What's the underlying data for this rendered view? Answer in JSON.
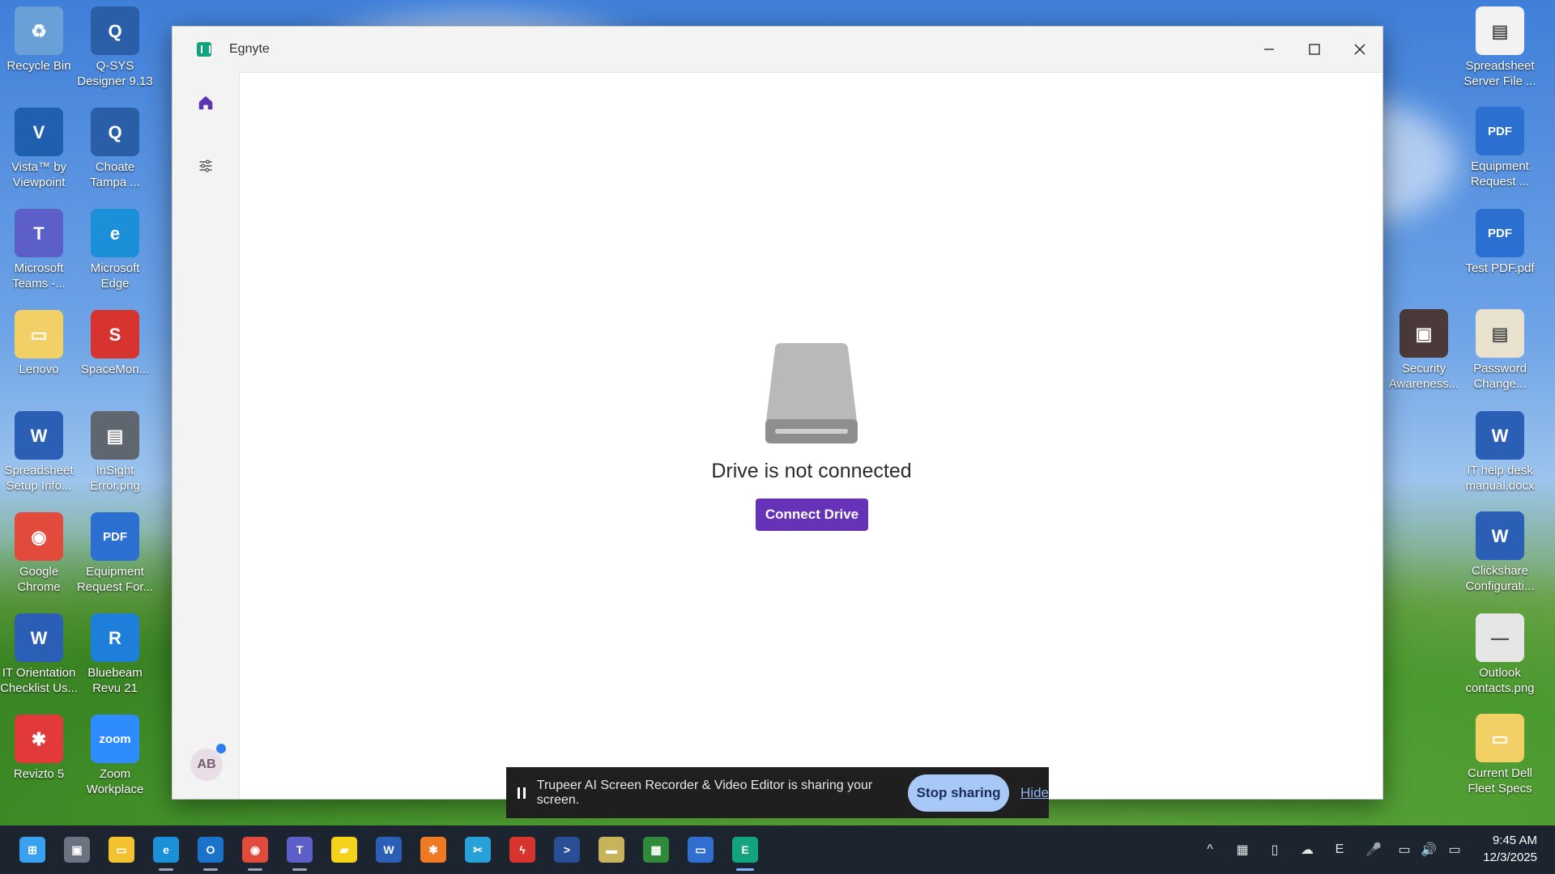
{
  "window": {
    "title": "Egnyte",
    "controls": {
      "minimize": "minimize-icon",
      "maximize": "maximize-icon",
      "close": "close-icon"
    }
  },
  "sidebar": {
    "home_icon": "home-icon",
    "settings_icon": "sliders-icon",
    "avatar_initials": "AB"
  },
  "main": {
    "status_text": "Drive is not connected",
    "connect_button": "Connect Drive"
  },
  "share_bar": {
    "message": "Trupeer AI Screen Recorder & Video Editor is sharing your screen.",
    "stop_button": "Stop sharing",
    "hide_link": "Hide"
  },
  "desktop_left": [
    {
      "label": "Recycle Bin",
      "color": "#6aa0d8",
      "glyph": "♻"
    },
    {
      "label": "Q-SYS\nDesigner 9.13",
      "color": "#2a5fa8",
      "glyph": "Q"
    },
    {
      "label": "Vista™ by\nViewpoint",
      "color": "#1f5fb0",
      "glyph": "V"
    },
    {
      "label": "Choate\nTampa ...",
      "color": "#2a5fa8",
      "glyph": "Q"
    },
    {
      "label": "Microsoft\nTeams -...",
      "color": "#5b5fc7",
      "glyph": "T"
    },
    {
      "label": "Microsoft\nEdge",
      "color": "#1b8fd8",
      "glyph": "e"
    },
    {
      "label": "Lenovo",
      "color": "#f2d066",
      "glyph": "▭"
    },
    {
      "label": "SpaceMon...",
      "color": "#d7342f",
      "glyph": "S"
    },
    {
      "label": "Spreadsheet\nSetup Info...",
      "color": "#2b5fb5",
      "glyph": "W"
    },
    {
      "label": "InSight\nError.png",
      "color": "#5f6670",
      "glyph": "▤"
    },
    {
      "label": "Google\nChrome",
      "color": "#e24b3b",
      "glyph": "◉"
    },
    {
      "label": "Equipment\nRequest For...",
      "color": "#2b6fd1",
      "glyph": "PDF"
    },
    {
      "label": "IT Orientation\nChecklist Us...",
      "color": "#2b5fb5",
      "glyph": "W"
    },
    {
      "label": "Bluebeam\nRevu 21",
      "color": "#1d7fd9",
      "glyph": "R"
    },
    {
      "label": "Revizto 5",
      "color": "#e23a3a",
      "glyph": "✱"
    },
    {
      "label": "Zoom\nWorkplace",
      "color": "#2d8cff",
      "glyph": "zoom"
    }
  ],
  "desktop_right": [
    {
      "label": "Spreadsheet\nServer File ...",
      "color": "#f2f2f2",
      "glyph": "▤"
    },
    {
      "label": "Equipment\nRequest ...",
      "color": "#2b6fd1",
      "glyph": "PDF"
    },
    {
      "label": "Test PDF.pdf",
      "color": "#2b6fd1",
      "glyph": "PDF"
    },
    {
      "label": "Security\nAwareness...",
      "color": "#4a3a3a",
      "glyph": "▣"
    },
    {
      "label": "Password\nChange...",
      "color": "#e8e2cf",
      "glyph": "▤"
    },
    {
      "label": "IT help desk\nmanual.docx",
      "color": "#2b5fb5",
      "glyph": "W"
    },
    {
      "label": "Clickshare\nConfigurati...",
      "color": "#2b5fb5",
      "glyph": "W"
    },
    {
      "label": "Outlook\ncontacts.png",
      "color": "#e6e6e6",
      "glyph": "—"
    },
    {
      "label": "Current Dell\nFleet Specs",
      "color": "#f2d066",
      "glyph": "▭"
    }
  ],
  "taskbar": {
    "apps": [
      {
        "name": "start-button",
        "color": "#3aa0f0",
        "glyph": "⊞"
      },
      {
        "name": "task-view-icon",
        "color": "#6b7380",
        "glyph": "▣"
      },
      {
        "name": "file-explorer-icon",
        "color": "#f2c230",
        "glyph": "▭"
      },
      {
        "name": "edge-icon",
        "color": "#1b8fd8",
        "glyph": "e"
      },
      {
        "name": "outlook-icon",
        "color": "#1a73c8",
        "glyph": "O"
      },
      {
        "name": "chrome-icon",
        "color": "#e24b3b",
        "glyph": "◉"
      },
      {
        "name": "teams-icon",
        "color": "#5b5fc7",
        "glyph": "T"
      },
      {
        "name": "sticky-notes-icon",
        "color": "#f5d21a",
        "glyph": "▰"
      },
      {
        "name": "word-icon",
        "color": "#2b5fb5",
        "glyph": "W"
      },
      {
        "name": "revizto-icon",
        "color": "#f07a24",
        "glyph": "✱"
      },
      {
        "name": "snipping-tool-icon",
        "color": "#2aa0d8",
        "glyph": "✂"
      },
      {
        "name": "acrobat-icon",
        "color": "#d7342f",
        "glyph": "ϟ"
      },
      {
        "name": "powershell-icon",
        "color": "#2a4e96",
        "glyph": ">"
      },
      {
        "name": "notes-icon",
        "color": "#c9b35a",
        "glyph": "▬"
      },
      {
        "name": "spreadsheet-icon",
        "color": "#2f8a3a",
        "glyph": "▦"
      },
      {
        "name": "remote-desktop-icon",
        "color": "#2f6fcf",
        "glyph": "▭"
      },
      {
        "name": "egnyte-taskbar-icon",
        "color": "#14a37f",
        "glyph": "E"
      }
    ],
    "tray": [
      {
        "name": "tray-overflow-icon",
        "glyph": "^"
      },
      {
        "name": "tray-app-icon",
        "glyph": "▦"
      },
      {
        "name": "usb-icon",
        "glyph": "▯"
      },
      {
        "name": "onedrive-icon",
        "glyph": "☁"
      },
      {
        "name": "egnyte-tray-icon",
        "glyph": "E"
      },
      {
        "name": "microphone-icon",
        "glyph": "🎤"
      },
      {
        "name": "network-icon",
        "glyph": "▭"
      },
      {
        "name": "volume-icon",
        "glyph": "🔊"
      },
      {
        "name": "battery-icon",
        "glyph": "▭"
      }
    ],
    "time": "9:45 AM",
    "date": "12/3/2025"
  }
}
